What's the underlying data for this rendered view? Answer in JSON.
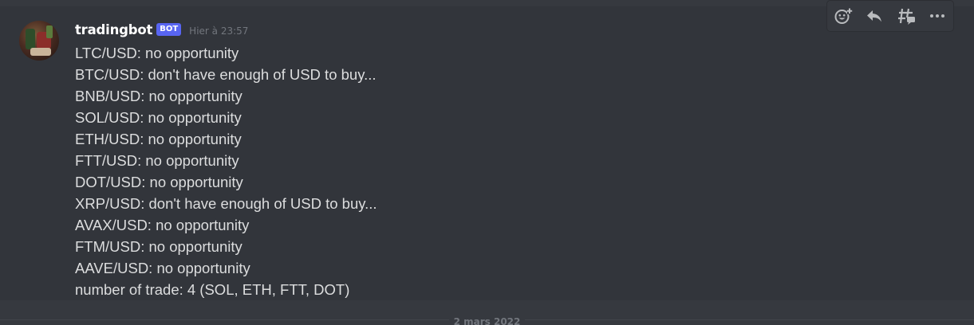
{
  "message": {
    "username": "tradingbot",
    "bot_tag": "BOT",
    "timestamp": "Hier à 23:57",
    "lines": [
      "LTC/USD: no opportunity",
      "BTC/USD: don't have enough of USD to buy...",
      "BNB/USD: no opportunity",
      "SOL/USD: no opportunity",
      "ETH/USD: no opportunity",
      "FTT/USD: no opportunity",
      "DOT/USD: no opportunity",
      "XRP/USD: don't have enough of USD to buy...",
      "AVAX/USD: no opportunity",
      "FTM/USD: no opportunity",
      "AAVE/USD: no opportunity",
      "number of trade: 4 (SOL, ETH, FTT, DOT)"
    ]
  },
  "toolbar": {
    "icons": [
      "add-reaction-icon",
      "reply-icon",
      "create-thread-icon",
      "more-icon"
    ]
  },
  "date_separator": "2 mars 2022",
  "colors": {
    "background": "#36393f",
    "message_hover": "#32353b",
    "bot_tag": "#5865f2",
    "text": "#dcddde",
    "muted": "#72767d"
  }
}
